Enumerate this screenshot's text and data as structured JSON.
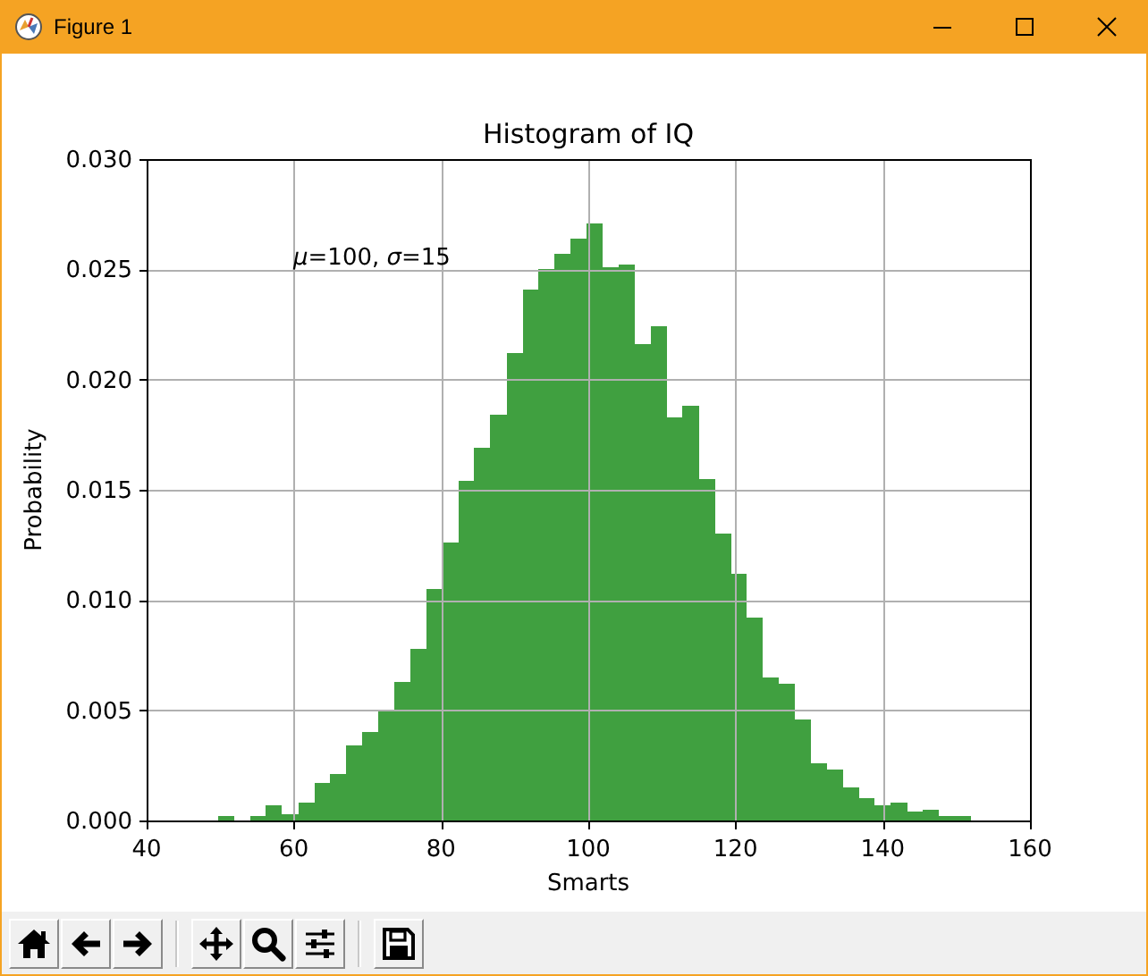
{
  "window": {
    "title": "Figure 1"
  },
  "figure": {
    "chart_data": {
      "type": "bar",
      "title": "Histogram of IQ",
      "xlabel": "Smarts",
      "ylabel": "Probability",
      "x": [
        50.8,
        53.0,
        55.2,
        57.3,
        59.5,
        61.7,
        63.9,
        66.0,
        68.2,
        70.4,
        72.6,
        74.7,
        76.9,
        79.1,
        81.3,
        83.5,
        85.6,
        87.8,
        90.0,
        92.2,
        94.3,
        96.5,
        98.7,
        100.9,
        103.0,
        105.2,
        107.4,
        109.6,
        111.7,
        113.9,
        116.1,
        118.3,
        120.4,
        122.6,
        124.8,
        127.0,
        129.1,
        131.3,
        133.5,
        135.7,
        137.8,
        140.0,
        142.2,
        144.4,
        146.5,
        148.7,
        150.9
      ],
      "series": [
        {
          "color": "#40a040",
          "values": [
            0.0002,
            0,
            0.0002,
            0.0007,
            0.0003,
            0.0008,
            0.0017,
            0.0021,
            0.0034,
            0.004,
            0.005,
            0.0063,
            0.0078,
            0.0105,
            0.0126,
            0.0154,
            0.0169,
            0.0184,
            0.0212,
            0.0241,
            0.025,
            0.0257,
            0.0264,
            0.0271,
            0.0251,
            0.0252,
            0.0216,
            0.0224,
            0.0183,
            0.0188,
            0.0155,
            0.013,
            0.0112,
            0.0092,
            0.0065,
            0.0062,
            0.0046,
            0.0026,
            0.0023,
            0.0015,
            0.001,
            0.0007,
            0.0008,
            0.0004,
            0.0005,
            0.0002,
            0.0002
          ]
        }
      ],
      "grid": true,
      "xlim": [
        40,
        160
      ],
      "ylim": [
        0,
        0.03
      ],
      "xticks": [
        40,
        60,
        80,
        100,
        120,
        140,
        160
      ],
      "yticks": [
        {
          "value": 0,
          "label": "0.000"
        },
        {
          "value": 0.005,
          "label": "0.005"
        },
        {
          "value": 0.01,
          "label": "0.010"
        },
        {
          "value": 0.015,
          "label": "0.015"
        },
        {
          "value": 0.02,
          "label": "0.020"
        },
        {
          "value": 0.025,
          "label": "0.025"
        },
        {
          "value": 0.03,
          "label": "0.030"
        }
      ],
      "annotations": [
        "*μ*=100,  *σ*=15"
      ]
    }
  },
  "toolbar": {
    "buttons": [
      {
        "kind": "home"
      },
      {
        "kind": "back"
      },
      {
        "kind": "forward"
      },
      {
        "kind": "separator"
      },
      {
        "kind": "pan"
      },
      {
        "kind": "zoom"
      },
      {
        "kind": "configure"
      },
      {
        "kind": "separator"
      },
      {
        "kind": "save"
      }
    ]
  }
}
